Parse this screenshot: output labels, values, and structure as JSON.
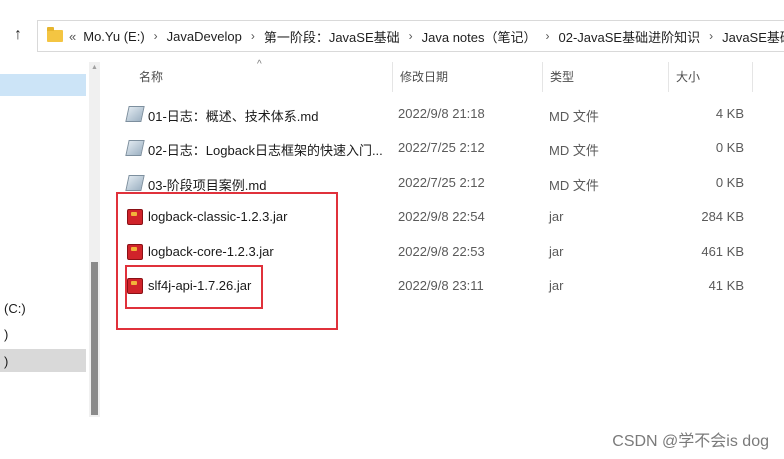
{
  "toolbar": {
    "up_symbol": "↑"
  },
  "address_bar": {
    "overflow": "«",
    "separator": "›",
    "crumbs": [
      "Mo.Yu (E:)",
      "JavaDevelop",
      "第一阶段：JavaSE基础",
      "Java notes（笔记）",
      "02-JavaSE基础进阶知识",
      "JavaSE基础进"
    ]
  },
  "nav": {
    "items": [
      "(C:)",
      ")",
      ")"
    ]
  },
  "columns": {
    "name": "名称",
    "date": "修改日期",
    "type": "类型",
    "size": "大小",
    "sort_indicator": "^"
  },
  "files": [
    {
      "name": "01-日志：概述、技术体系.md",
      "date": "2022/9/8 21:18",
      "type": "MD 文件",
      "size": "4 KB",
      "icon": "markdown-file-icon"
    },
    {
      "name": "02-日志：Logback日志框架的快速入门...",
      "date": "2022/7/25 2:12",
      "type": "MD 文件",
      "size": "0 KB",
      "icon": "markdown-file-icon"
    },
    {
      "name": "03-阶段项目案例.md",
      "date": "2022/7/25 2:12",
      "type": "MD 文件",
      "size": "0 KB",
      "icon": "markdown-file-icon"
    },
    {
      "name": "logback-classic-1.2.3.jar",
      "date": "2022/9/8 22:54",
      "type": "jar",
      "size": "284 KB",
      "icon": "jar-file-icon"
    },
    {
      "name": "logback-core-1.2.3.jar",
      "date": "2022/9/8 22:53",
      "type": "jar",
      "size": "461 KB",
      "icon": "jar-file-icon"
    },
    {
      "name": "slf4j-api-1.7.26.jar",
      "date": "2022/9/8 23:11",
      "type": "jar",
      "size": "41 KB",
      "icon": "jar-file-icon"
    }
  ],
  "annotation_color": "#e0313b",
  "watermark": "CSDN @学不会is dog"
}
